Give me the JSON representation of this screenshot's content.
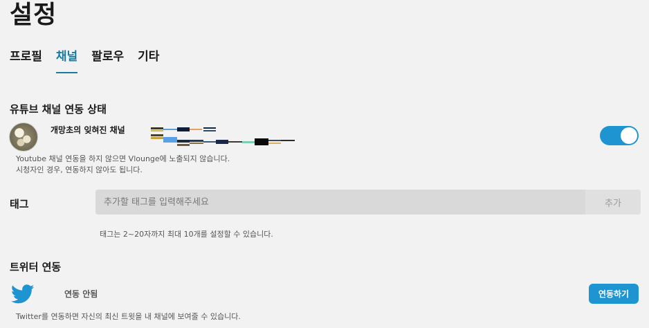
{
  "page": {
    "title": "설정"
  },
  "tabs": [
    {
      "label": "프로필",
      "active": false
    },
    {
      "label": "채널",
      "active": true
    },
    {
      "label": "팔로우",
      "active": false
    },
    {
      "label": "기타",
      "active": false
    }
  ],
  "youtube": {
    "section_title": "유튜브 채널 연동 상태",
    "channel_name": "개망초의 잊혀진 채널",
    "toggle_on": true,
    "help_line1": "Youtube 채널 연동을 하지 않으면 Vlounge에 노출되지 않습니다.",
    "help_line2": "시청자인 경우, 연동하지 않아도 됩니다."
  },
  "tags": {
    "label": "태그",
    "input_value": "",
    "placeholder": "추가할 태그를 입력해주세요",
    "add_button": "추가",
    "help": "태그는 2~20자까지 최대 10개를 설정할 수 있습니다."
  },
  "twitter": {
    "section_title": "트위터 연동",
    "status": "연동 안됨",
    "link_button": "연동하기",
    "help": "Twitter를 연동하면 자신의 최신 트윗을 내 채널에 보여줄 수 있습니다."
  },
  "colors": {
    "accent": "#1e95d1",
    "active_tab": "#1a7aa0",
    "background": "#f2f2f2"
  },
  "icons": {
    "twitter": "twitter-bird-icon",
    "avatar": "channel-avatar"
  }
}
